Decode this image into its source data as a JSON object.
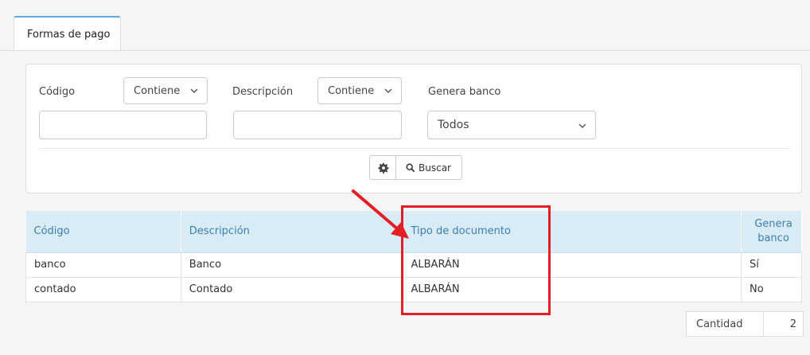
{
  "tabs": [
    {
      "label": "Formas de pago",
      "active": true
    }
  ],
  "filters": {
    "codigo": {
      "label": "Código",
      "operator": "Contiene",
      "value": ""
    },
    "descripcion": {
      "label": "Descripción",
      "operator": "Contiene",
      "value": ""
    },
    "genera_banco": {
      "label": "Genera banco",
      "value": "Todos"
    }
  },
  "actions": {
    "settings_icon": "gear-icon",
    "search_icon": "search-icon",
    "search_label": "Buscar"
  },
  "table": {
    "columns": [
      "Código",
      "Descripción",
      "Tipo de documento",
      "Genera banco"
    ],
    "rows": [
      {
        "codigo": "banco",
        "descripcion": "Banco",
        "tipo_documento": "ALBARÁN",
        "genera_banco": "Sí"
      },
      {
        "codigo": "contado",
        "descripcion": "Contado",
        "tipo_documento": "ALBARÁN",
        "genera_banco": "No"
      }
    ]
  },
  "footer": {
    "count_label": "Cantidad",
    "count_value": "2"
  },
  "colors": {
    "header_bg": "#d9ecf6",
    "header_text": "#3a7fb0",
    "annotation": "#e31e24",
    "tab_accent": "#5fa8dc"
  }
}
